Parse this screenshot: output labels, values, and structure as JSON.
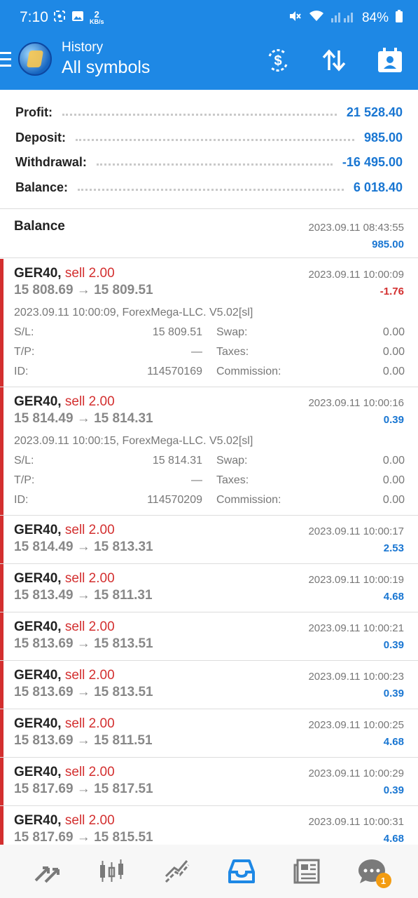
{
  "status_bar": {
    "time": "7:10",
    "speed_value": "2",
    "speed_unit": "KB/s",
    "battery": "84%"
  },
  "app_bar": {
    "title": "History",
    "subtitle": "All symbols",
    "actions": [
      "currency-exchange-icon",
      "sort-icon",
      "calendar-icon"
    ]
  },
  "summary": {
    "profit_label": "Profit:",
    "profit_value": "21 528.40",
    "deposit_label": "Deposit:",
    "deposit_value": "985.00",
    "withdrawal_label": "Withdrawal:",
    "withdrawal_value": "-16 495.00",
    "balance_label": "Balance:",
    "balance_value": "6 018.40"
  },
  "balance_entry": {
    "title": "Balance",
    "date": "2023.09.11 08:43:55",
    "amount": "985.00"
  },
  "deals": [
    {
      "symbol": "GER40,",
      "side": "sell 2.00",
      "price": "15 808.69 → 15 809.51",
      "date": "2023.09.11 10:00:09",
      "profit": "-1.76",
      "comment": "2023.09.11 10:00:09, ForexMega-LLC. V5.02[sl]",
      "sl_label": "S/L:",
      "sl_value": "15 809.51",
      "swap_label": "Swap:",
      "swap_value": "0.00",
      "tp_label": "T/P:",
      "tp_value": "—",
      "taxes_label": "Taxes:",
      "taxes_value": "0.00",
      "id_label": "ID:",
      "id_value": "114570169",
      "commission_label": "Commission:",
      "commission_value": "0.00"
    },
    {
      "symbol": "GER40,",
      "side": "sell 2.00",
      "price": "15 814.49 → 15 814.31",
      "date": "2023.09.11 10:00:16",
      "profit": "0.39",
      "comment": "2023.09.11 10:00:15, ForexMega-LLC. V5.02[sl]",
      "sl_label": "S/L:",
      "sl_value": "15 814.31",
      "swap_label": "Swap:",
      "swap_value": "0.00",
      "tp_label": "T/P:",
      "tp_value": "—",
      "taxes_label": "Taxes:",
      "taxes_value": "0.00",
      "id_label": "ID:",
      "id_value": "114570209",
      "commission_label": "Commission:",
      "commission_value": "0.00"
    },
    {
      "symbol": "GER40,",
      "side": "sell 2.00",
      "price": "15 814.49 → 15 813.31",
      "date": "2023.09.11 10:00:17",
      "profit": "2.53"
    },
    {
      "symbol": "GER40,",
      "side": "sell 2.00",
      "price": "15 813.49 → 15 811.31",
      "date": "2023.09.11 10:00:19",
      "profit": "4.68"
    },
    {
      "symbol": "GER40,",
      "side": "sell 2.00",
      "price": "15 813.69 → 15 813.51",
      "date": "2023.09.11 10:00:21",
      "profit": "0.39"
    },
    {
      "symbol": "GER40,",
      "side": "sell 2.00",
      "price": "15 813.69 → 15 813.51",
      "date": "2023.09.11 10:00:23",
      "profit": "0.39"
    },
    {
      "symbol": "GER40,",
      "side": "sell 2.00",
      "price": "15 813.69 → 15 811.51",
      "date": "2023.09.11 10:00:25",
      "profit": "4.68"
    },
    {
      "symbol": "GER40,",
      "side": "sell 2.00",
      "price": "15 817.69 → 15 817.51",
      "date": "2023.09.11 10:00:29",
      "profit": "0.39"
    },
    {
      "symbol": "GER40,",
      "side": "sell 2.00",
      "price": "15 817.69 → 15 815.51",
      "date": "2023.09.11 10:00:31",
      "profit": "4.68"
    }
  ],
  "bottom_nav": {
    "items": [
      "quotes-icon",
      "chart-icon",
      "trade-icon",
      "history-icon",
      "news-icon",
      "chat-icon"
    ],
    "active": "history-icon",
    "chat_badge": "1"
  },
  "colors": {
    "primary": "#1e88e5",
    "sell": "#d32f2f",
    "positive": "#1976d2",
    "badge": "#f39c12"
  }
}
